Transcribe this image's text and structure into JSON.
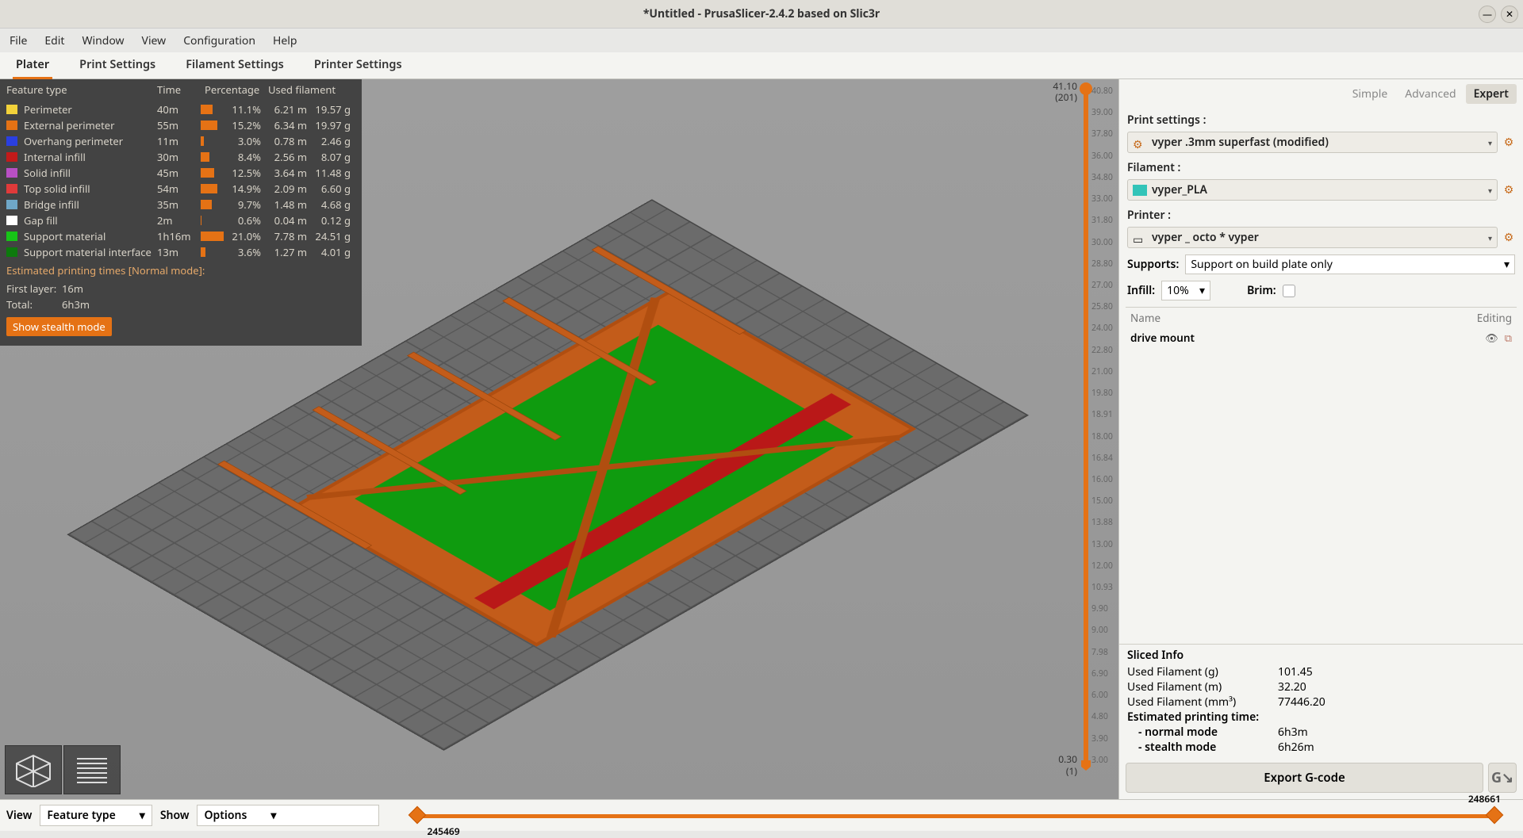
{
  "window": {
    "title": "*Untitled - PrusaSlicer-2.4.2 based on Slic3r"
  },
  "menubar": [
    "File",
    "Edit",
    "Window",
    "View",
    "Configuration",
    "Help"
  ],
  "tabs": [
    "Plater",
    "Print Settings",
    "Filament Settings",
    "Printer Settings"
  ],
  "legend": {
    "headers": [
      "Feature type",
      "Time",
      "Percentage",
      "Used filament"
    ],
    "rows": [
      {
        "color": "#f2d23a",
        "name": "Perimeter",
        "time": "40m",
        "pct": "11.1%",
        "len": "6.21 m",
        "wt": "19.57 g",
        "bar": 11
      },
      {
        "color": "#e57215",
        "name": "External perimeter",
        "time": "55m",
        "pct": "15.2%",
        "len": "6.34 m",
        "wt": "19.97 g",
        "bar": 15
      },
      {
        "color": "#2a3fe0",
        "name": "Overhang perimeter",
        "time": "11m",
        "pct": "3.0%",
        "len": "0.78 m",
        "wt": "2.46 g",
        "bar": 3
      },
      {
        "color": "#c21a1a",
        "name": "Internal infill",
        "time": "30m",
        "pct": "8.4%",
        "len": "2.56 m",
        "wt": "8.07 g",
        "bar": 8
      },
      {
        "color": "#b84fc4",
        "name": "Solid infill",
        "time": "45m",
        "pct": "12.5%",
        "len": "3.64 m",
        "wt": "11.48 g",
        "bar": 12
      },
      {
        "color": "#e03a3a",
        "name": "Top solid infill",
        "time": "54m",
        "pct": "14.9%",
        "len": "2.09 m",
        "wt": "6.60 g",
        "bar": 15
      },
      {
        "color": "#6fa7c7",
        "name": "Bridge infill",
        "time": "35m",
        "pct": "9.7%",
        "len": "1.48 m",
        "wt": "4.68 g",
        "bar": 10
      },
      {
        "color": "#ffffff",
        "name": "Gap fill",
        "time": "2m",
        "pct": "0.6%",
        "len": "0.04 m",
        "wt": "0.12 g",
        "bar": 1
      },
      {
        "color": "#17c417",
        "name": "Support material",
        "time": "1h16m",
        "pct": "21.0%",
        "len": "7.78 m",
        "wt": "24.51 g",
        "bar": 21
      },
      {
        "color": "#0d7a0d",
        "name": "Support material interface",
        "time": "13m",
        "pct": "3.6%",
        "len": "1.27 m",
        "wt": "4.01 g",
        "bar": 4
      }
    ],
    "est_label": "Estimated printing times [Normal mode]:",
    "first_layer_k": "First layer:",
    "first_layer_v": "16m",
    "total_k": "Total:",
    "total_v": "6h3m",
    "stealth_btn": "Show stealth mode"
  },
  "layerslider": {
    "top_val": "41.10",
    "top_idx": "(201)",
    "bot_val": "0.30",
    "bot_idx": "(1)",
    "ticks": [
      "40.80",
      "39.00",
      "37.80",
      "36.00",
      "34.80",
      "33.00",
      "31.80",
      "30.00",
      "28.80",
      "27.00",
      "25.80",
      "24.00",
      "22.80",
      "21.00",
      "19.80",
      "18.91",
      "18.00",
      "16.84",
      "16.00",
      "15.00",
      "13.88",
      "13.00",
      "12.00",
      "10.93",
      "9.90",
      "9.00",
      "7.98",
      "6.90",
      "6.00",
      "4.80",
      "3.90",
      "3.00"
    ]
  },
  "right": {
    "modes": [
      "Simple",
      "Advanced",
      "Expert"
    ],
    "active_mode": 2,
    "print_settings_lbl": "Print settings :",
    "print_settings_val": "vyper .3mm superfast (modified)",
    "filament_lbl": "Filament :",
    "filament_val": "vyper_PLA",
    "filament_color": "#33c4b8",
    "printer_lbl": "Printer :",
    "printer_val": "vyper _ octo * vyper",
    "supports_lbl": "Supports:",
    "supports_val": "Support on build plate only",
    "infill_lbl": "Infill:",
    "infill_val": "10%",
    "brim_lbl": "Brim:",
    "objlist_hd_name": "Name",
    "objlist_hd_edit": "Editing",
    "object_name": "drive mount",
    "sliced_title": "Sliced Info",
    "sliced_rows": [
      {
        "k": "Used Filament (g)",
        "v": "101.45"
      },
      {
        "k": "Used Filament (m)",
        "v": "32.20"
      },
      {
        "k": "Used Filament (mm³)",
        "v": "77446.20"
      }
    ],
    "ept_lbl": "Estimated printing time:",
    "ept_modes": [
      {
        "k": "- normal mode",
        "v": "6h3m"
      },
      {
        "k": "- stealth mode",
        "v": "6h26m"
      }
    ],
    "export_btn": "Export G-code"
  },
  "bottom": {
    "view_lbl": "View",
    "featuretype_lbl": "Feature type",
    "show_lbl": "Show",
    "options_lbl": "Options",
    "slider_max": "248661",
    "slider_val": "245469"
  }
}
